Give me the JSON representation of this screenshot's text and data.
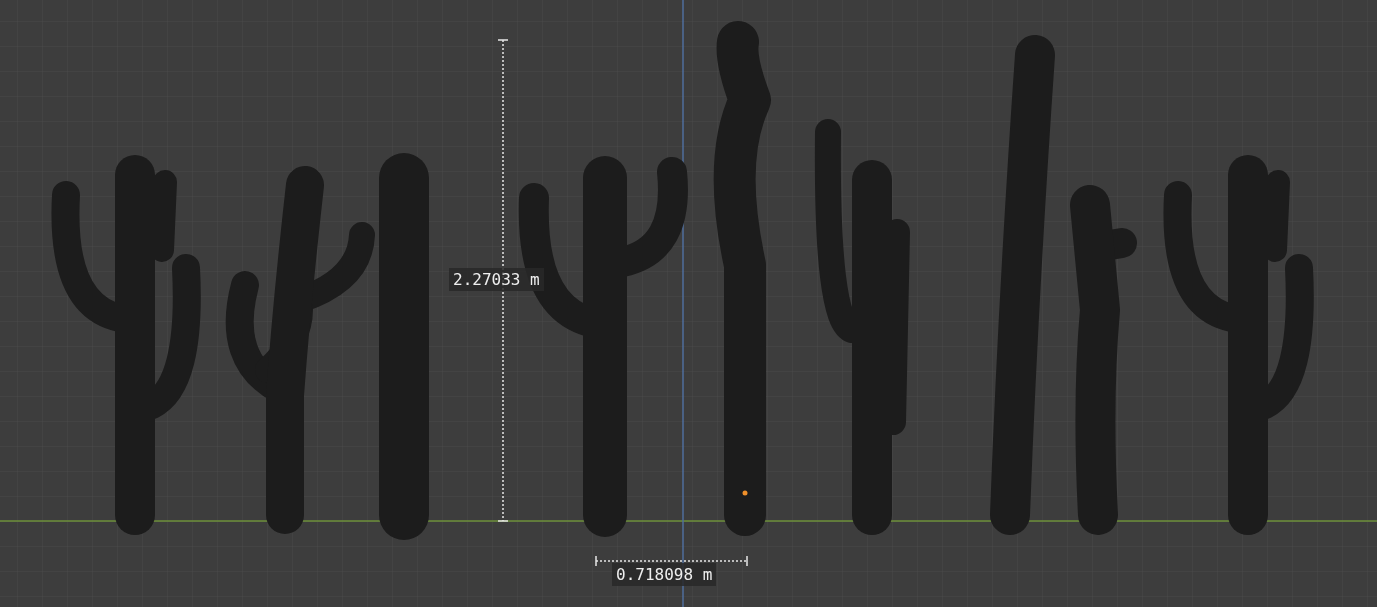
{
  "viewport": {
    "measurements": [
      {
        "kind": "vertical",
        "label": "2.27033 m"
      },
      {
        "kind": "horizontal",
        "label": "0.718098 m"
      }
    ]
  }
}
